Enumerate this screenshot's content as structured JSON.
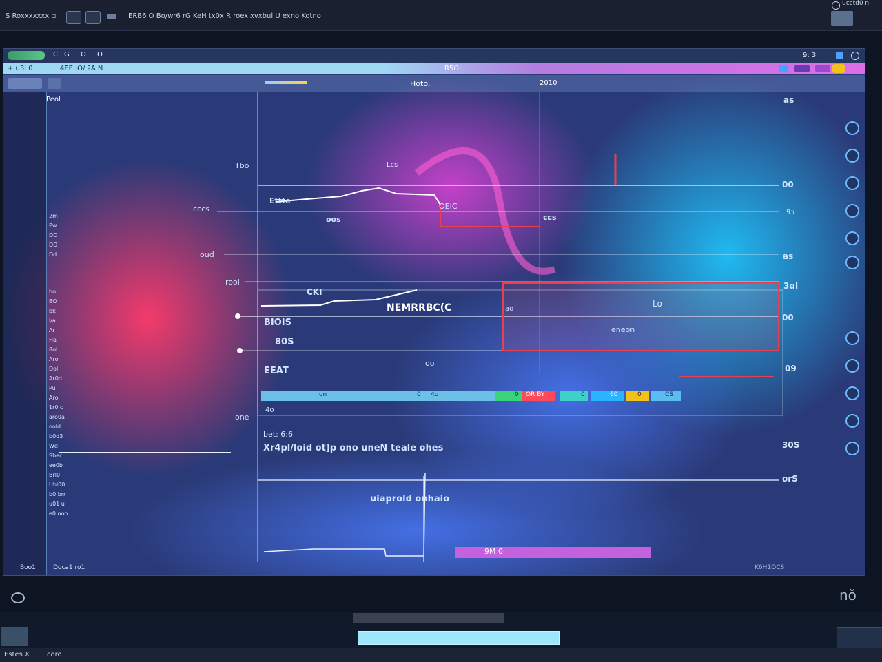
{
  "os_bar": {
    "menu_left": "S  Roxxxxxxx  ▫",
    "title_mid": "ERB6 O Bo/wr6 rG   KeH tx0x   R  roex'xvxbul   U exno Kotno",
    "right_label": "ucctd0 n"
  },
  "app_bar": {
    "icons_left": [
      "logo",
      "C",
      "G",
      "O",
      "O"
    ],
    "right_label": "9: 3"
  },
  "title_strip": {
    "left_label": "+ u3l 0",
    "path_label": "4EE IO/ ?A N",
    "center_tag": "R5OI"
  },
  "tool_row": {
    "left_label": "Hoto,",
    "mid_label": "2010",
    "sub_label": "Peol"
  },
  "left_sidebar": {
    "items": [
      "2m",
      "Pw",
      "DD",
      "DD",
      "Dd",
      "bo",
      "BO",
      "bk",
      "l/a",
      "Ar",
      "Ha",
      "8ol",
      "Arol",
      "Dol",
      "Ar0d",
      "Pu",
      "Arol",
      "1r0 c",
      "aro0a",
      "oold",
      "b0d3",
      "Wd",
      "Sbeci",
      "ee0b",
      "Brl0",
      "Ubl00",
      "b0 brr",
      "u01 u",
      "e0 ooo"
    ],
    "footer_left": "Boo1",
    "footer_mid": "Doca1 ro1"
  },
  "plot": {
    "left_axis_labels": [
      "Tbo",
      "cccs",
      "oud",
      "rooi",
      "one"
    ],
    "right_axis_labels": [
      "as",
      "00",
      "9ɔ",
      "as",
      "3ɑl",
      "00",
      "09"
    ],
    "inner_labels": {
      "top_a": "Lcs",
      "top_b": "Ettte",
      "top_c": "oos",
      "top_d": "OEIC",
      "top_e": "ccs",
      "mid_title": "NEMRRBC(C",
      "mid_a": "CKI",
      "mid_b": "BIOIS",
      "mid_c": "80S",
      "mid_d": "EEAT",
      "mid_e": "ao",
      "mid_f": "Lo",
      "mid_g": "eneon",
      "mid_h": "oo",
      "base": "4o"
    },
    "lower_panel": {
      "label_a": "bet:  6:6",
      "label_b": "Xr4pl/loid    ot]p ono    uneN   teale ohes",
      "label_c": "uiaprold onhaio",
      "right_top": "30S",
      "right_bot": "orS"
    },
    "legend_row": [
      "on",
      "0",
      "4o",
      "0",
      "OR BY",
      "0",
      "60",
      "0",
      "CS"
    ],
    "bottom_track_label": "9M   0",
    "corner_bottom_right": "K6H1OCS"
  },
  "bottom": {
    "left_label": "Estes X",
    "right_label": "coro",
    "brand": "nŏ"
  },
  "colors": {
    "accent_cyan": "#9ee6fb",
    "accent_magenta": "#e05fd9",
    "plot_red": "#e84050",
    "grid_white": "#e8f0ff"
  }
}
